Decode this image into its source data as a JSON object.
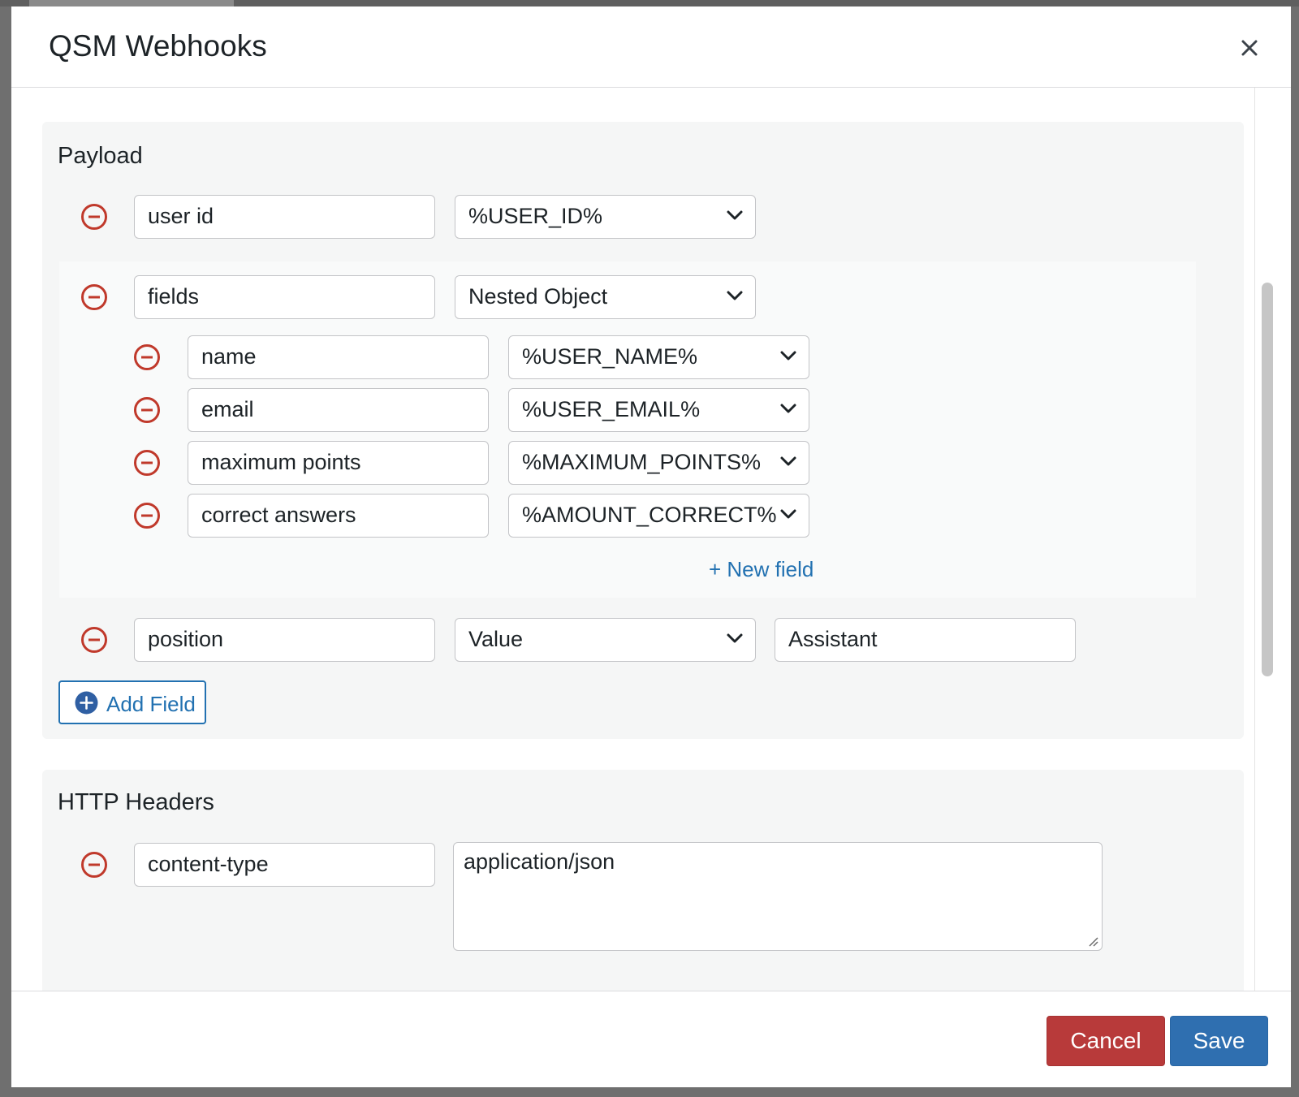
{
  "modal": {
    "title": "QSM Webhooks",
    "close_label": "×"
  },
  "payload": {
    "title": "Payload",
    "rows": [
      {
        "key": "user id",
        "type": "%USER_ID%"
      },
      {
        "key": "fields",
        "type": "Nested Object",
        "children": [
          {
            "key": "name",
            "type": "%USER_NAME%"
          },
          {
            "key": "email",
            "type": "%USER_EMAIL%"
          },
          {
            "key": "maximum points",
            "type": "%MAXIMUM_POINTS%"
          },
          {
            "key": "correct answers",
            "type": "%AMOUNT_CORRECT%"
          }
        ],
        "new_field_label": "+ New field"
      },
      {
        "key": "position",
        "type": "Value",
        "value": "Assistant"
      }
    ],
    "add_field_label": "Add Field"
  },
  "headers": {
    "title": "HTTP Headers",
    "rows": [
      {
        "key": "content-type",
        "value": "application/json"
      }
    ]
  },
  "footer": {
    "cancel_label": "Cancel",
    "save_label": "Save"
  },
  "colors": {
    "remove": "#c0392b",
    "link": "#2271b1",
    "cancel": "#b83a3a",
    "save": "#2f6fb0"
  }
}
